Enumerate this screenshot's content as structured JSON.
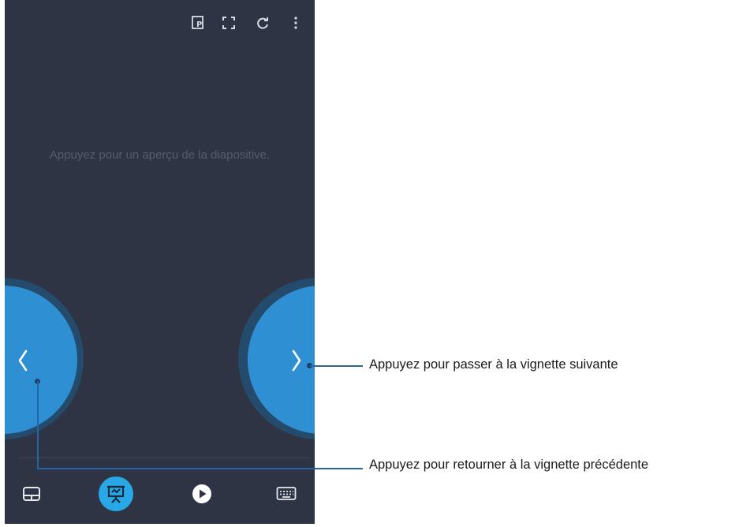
{
  "topbar": {
    "icons": [
      "presenter-icon",
      "fullscreen-icon",
      "refresh-icon",
      "more-vert-icon"
    ]
  },
  "main": {
    "hint": "Appuyez pour un aperçu de la diapositive."
  },
  "nav": {
    "prev_glyph": "‹",
    "next_glyph": "›"
  },
  "bottombar": {
    "items": [
      "touchpad-icon",
      "presentation-icon",
      "play-icon",
      "keyboard-icon"
    ],
    "active": "presentation-icon"
  },
  "callouts": {
    "next": "Appuyez pour passer à la vignette suivante",
    "prev": "Appuyez pour retourner à la vignette précédente"
  },
  "colors": {
    "background": "#2e3444",
    "button": "#2f8fd3",
    "button_ring": "#254b6c",
    "active": "#29a8e8",
    "callout_line": "#2464a8"
  }
}
